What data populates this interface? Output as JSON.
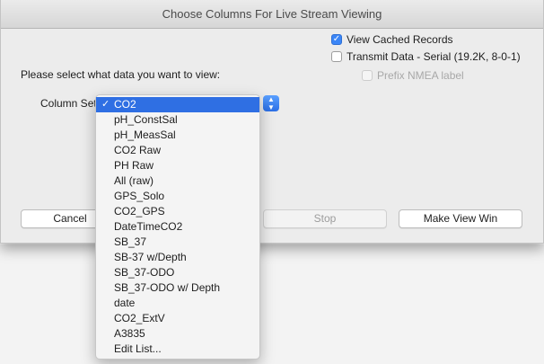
{
  "window": {
    "title": "Choose Columns For Live Stream Viewing"
  },
  "options": {
    "view_cached": {
      "label": "View Cached Records",
      "checked": true
    },
    "transmit": {
      "label": "Transmit Data - Serial (19.2K, 8-0-1)",
      "checked": false
    },
    "prefix_nmea": {
      "label": "Prefix NMEA label",
      "checked": false,
      "enabled": false
    }
  },
  "prompt": "Please select what data you want to view:",
  "column_set": {
    "label": "Column Set",
    "selected": "CO2",
    "items": [
      "CO2",
      "pH_ConstSal",
      "pH_MeasSal",
      "CO2 Raw",
      "PH Raw",
      "All (raw)",
      "GPS_Solo",
      "CO2_GPS",
      "DateTimeCO2",
      "SB_37",
      "SB-37 w/Depth",
      "SB_37-ODO",
      "SB_37-ODO w/ Depth",
      "date",
      "CO2_ExtV",
      "A3835",
      "Edit List..."
    ]
  },
  "buttons": {
    "cancel": "Cancel",
    "stop": "Stop",
    "make_view": "Make View Win"
  },
  "icons": {
    "checkmark": "✓",
    "select_arrows": "▲▼"
  },
  "colors": {
    "accent": "#2f6fe3",
    "checkbox_on": "#3b86f7"
  }
}
